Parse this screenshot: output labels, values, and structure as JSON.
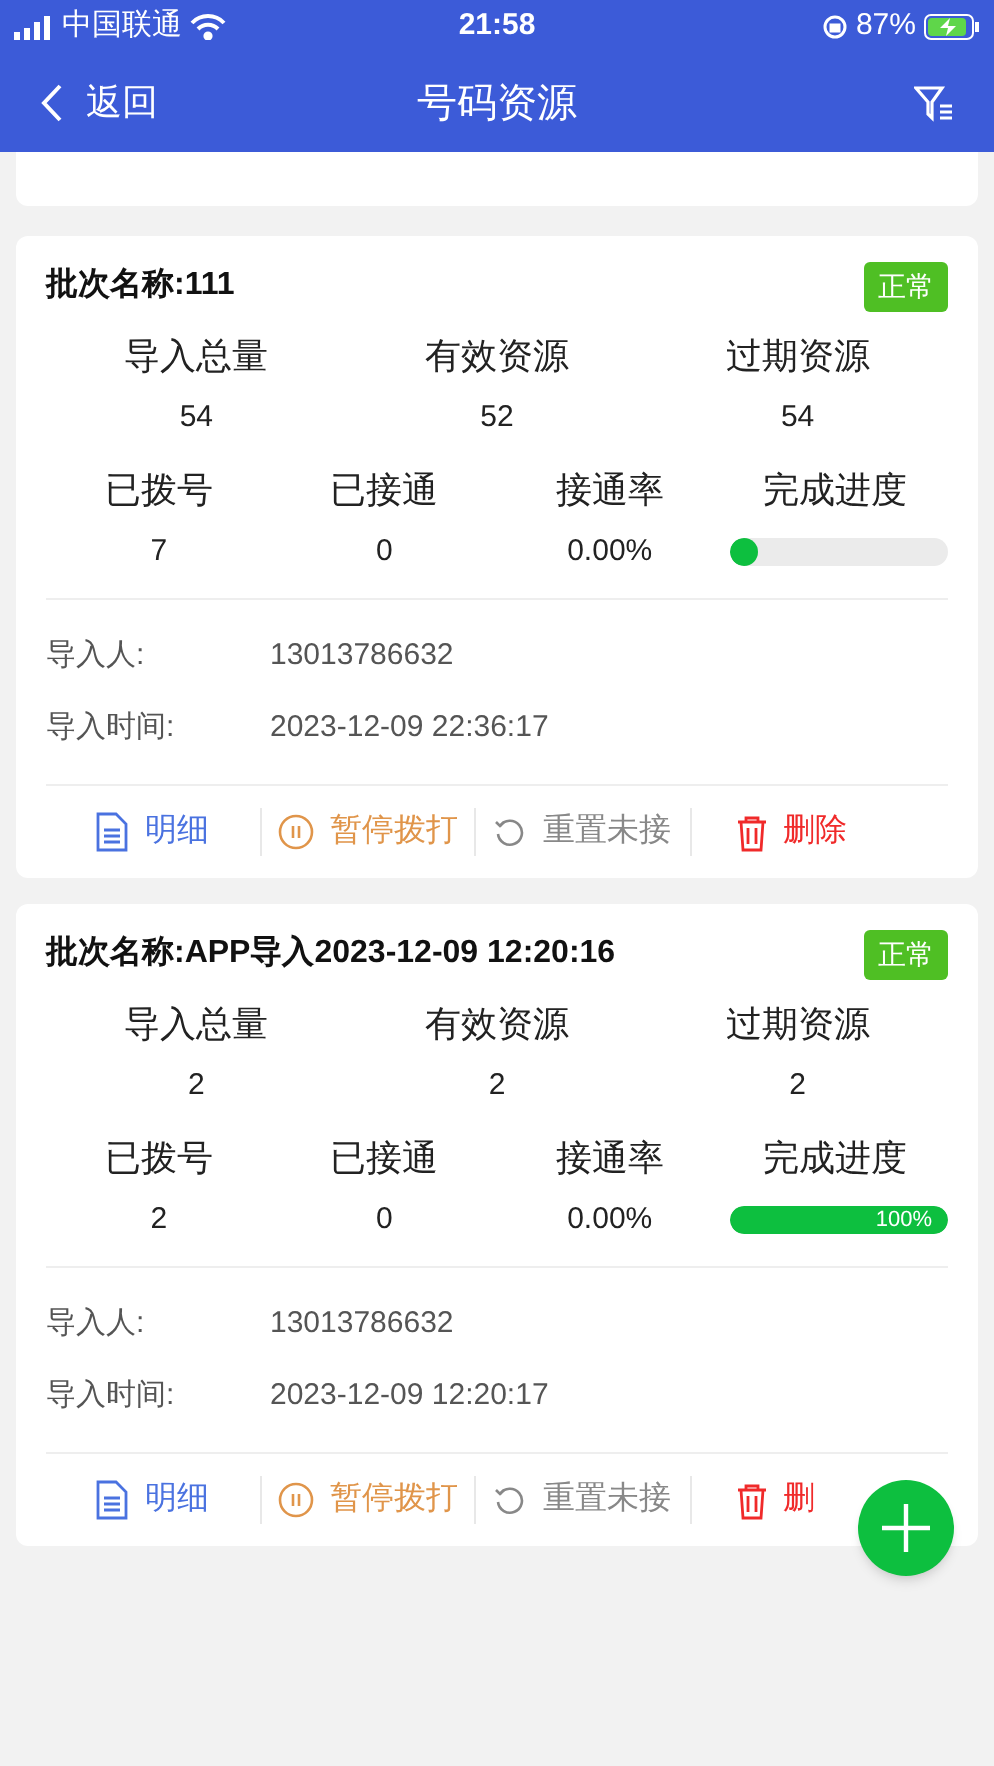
{
  "status_bar": {
    "carrier": "中国联通",
    "time": "21:58",
    "battery": "87%"
  },
  "nav": {
    "back": "返回",
    "title": "号码资源"
  },
  "cards": [
    {
      "batch_label": "批次名称:",
      "batch_name": "111",
      "status": "正常",
      "stats": [
        {
          "label": "导入总量",
          "value": "54"
        },
        {
          "label": "有效资源",
          "value": "52"
        },
        {
          "label": "过期资源",
          "value": "54"
        },
        {
          "label": "已拨号",
          "value": "7"
        },
        {
          "label": "已接通",
          "value": "0"
        },
        {
          "label": "接通率",
          "value": "0.00%"
        }
      ],
      "progress_label": "完成进度",
      "level": 0.04,
      "info": [
        {
          "label": "导入人:",
          "value": "13013786632"
        },
        {
          "label": "导入时间:",
          "value": "2023-12-09 22:36:17"
        }
      ],
      "actions": [
        {
          "kind": "detail",
          "label": "明细"
        },
        {
          "kind": "pause",
          "label": "暂停拨打"
        },
        {
          "kind": "reset",
          "label": "重置未接"
        },
        {
          "kind": "delete",
          "label": "删除"
        }
      ]
    },
    {
      "batch_label": "批次名称:",
      "batch_name": "APP导入2023-12-09 12:20:16",
      "status": "正常",
      "stats": [
        {
          "label": "导入总量",
          "value": "2"
        },
        {
          "label": "有效资源",
          "value": "2"
        },
        {
          "label": "过期资源",
          "value": "2"
        },
        {
          "label": "已拨号",
          "value": "2"
        },
        {
          "label": "已接通",
          "value": "0"
        },
        {
          "label": "接通率",
          "value": "0.00%"
        }
      ],
      "progress_label": "完成进度",
      "level": 1,
      "progress_text": "100%",
      "info": [
        {
          "label": "导入人:",
          "value": "13013786632"
        },
        {
          "label": "导入时间:",
          "value": "2023-12-09 12:20:17"
        }
      ],
      "actions": [
        {
          "kind": "detail",
          "label": "明细"
        },
        {
          "kind": "pause",
          "label": "暂停拨打"
        },
        {
          "kind": "reset",
          "label": "重置未接"
        },
        {
          "kind": "delete",
          "label": "删"
        }
      ]
    }
  ]
}
